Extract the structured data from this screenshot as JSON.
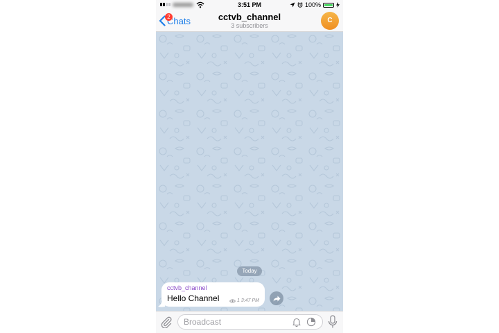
{
  "status_bar": {
    "time": "3:51 PM",
    "battery_percent": "100%",
    "icons": [
      "signal-icon",
      "wifi-icon",
      "location-arrow-icon",
      "alarm-icon",
      "battery-icon",
      "charging-icon"
    ]
  },
  "nav": {
    "back_label": "Chats",
    "unread_count": "2",
    "title": "cctvb_channel",
    "subtitle": "3 subscribers",
    "avatar_initial": "C",
    "avatar_color": "#F29A2E",
    "accent_color": "#1E7EE8"
  },
  "chat": {
    "date_label": "Today",
    "wallpaper_color": "#C9D8E7",
    "messages": [
      {
        "author": "cctvb_channel",
        "author_color": "#8A49C7",
        "text": "Hello Channel",
        "views": "1",
        "time": "3:47 PM"
      }
    ]
  },
  "input_bar": {
    "placeholder": "Broadcast",
    "icons": [
      "paperclip-icon",
      "bell-icon",
      "timer-icon",
      "microphone-icon"
    ]
  }
}
